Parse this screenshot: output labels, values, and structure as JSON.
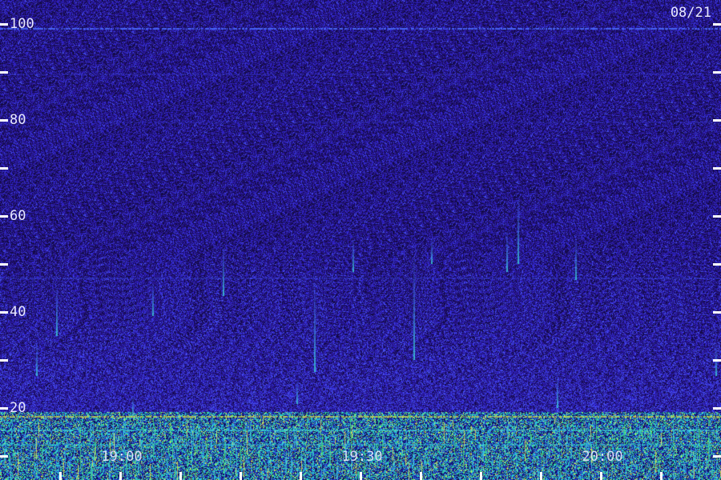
{
  "date": "08/21",
  "y_axis": {
    "labels": [
      "100",
      "80",
      "60",
      "40",
      "20"
    ]
  },
  "x_axis": {
    "labels": [
      "19:00",
      "19:30",
      "20:00"
    ]
  },
  "colors": {
    "background": "#2a1a78",
    "noise_dark": "#1a0f55",
    "noise_blue": "#3a3ad8",
    "signal_cyan": "#30d0e0",
    "signal_green": "#40e080",
    "signal_yellow": "#e0e040"
  }
}
